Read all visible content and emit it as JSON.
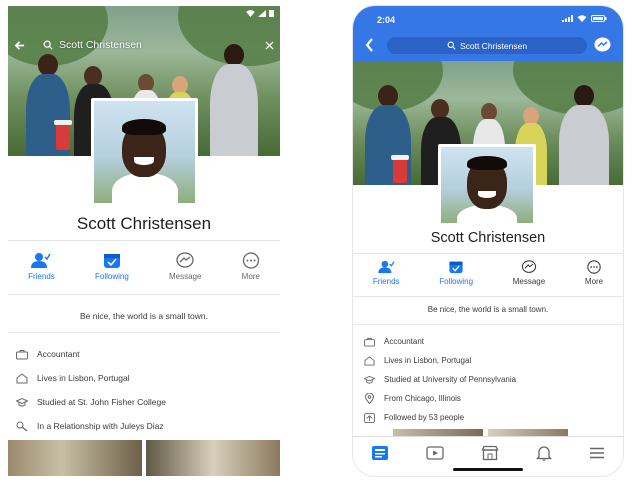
{
  "android": {
    "search_text": "Scott Christensen",
    "profile_name": "Scott Christensen",
    "actions": [
      {
        "label": "Friends",
        "icon": "friends-icon"
      },
      {
        "label": "Following",
        "icon": "following-icon"
      },
      {
        "label": "Message",
        "icon": "messenger-icon"
      },
      {
        "label": "More",
        "icon": "more-icon"
      }
    ],
    "bio": "Be nice, the world is a small town.",
    "details": [
      {
        "icon": "briefcase-icon",
        "text": "Accountant"
      },
      {
        "icon": "home-icon",
        "text": "Lives in Lisbon, Portugal"
      },
      {
        "icon": "graduation-cap-icon",
        "text": "Studied at St. John Fisher College"
      },
      {
        "icon": "relationship-icon",
        "text": "In a Relationship with Juleys Diaz"
      }
    ]
  },
  "iphone": {
    "time": "2:04",
    "search_text": "Scott Christensen",
    "profile_name": "Scott Christensen",
    "actions": [
      {
        "label": "Friends",
        "icon": "friends-icon"
      },
      {
        "label": "Following",
        "icon": "following-icon"
      },
      {
        "label": "Message",
        "icon": "messenger-icon"
      },
      {
        "label": "More",
        "icon": "more-icon"
      }
    ],
    "bio": "Be nice, the world is a small town.",
    "details": [
      {
        "icon": "briefcase-icon",
        "text": "Accountant"
      },
      {
        "icon": "home-icon",
        "text": "Lives in Lisbon, Portugal"
      },
      {
        "icon": "graduation-cap-icon",
        "text": "Studied at University of Pennsylvania"
      },
      {
        "icon": "location-pin-icon",
        "text": "From Chicago, Illinois"
      },
      {
        "icon": "followers-icon",
        "text": "Followed by 53 people"
      }
    ],
    "tabs": [
      "news-feed-icon",
      "watch-icon",
      "marketplace-icon",
      "notifications-bell-icon",
      "menu-icon"
    ]
  },
  "colors": {
    "brand_blue": "#1877f2",
    "ios_header_blue": "#3578e5",
    "text_secondary": "#65676b"
  }
}
